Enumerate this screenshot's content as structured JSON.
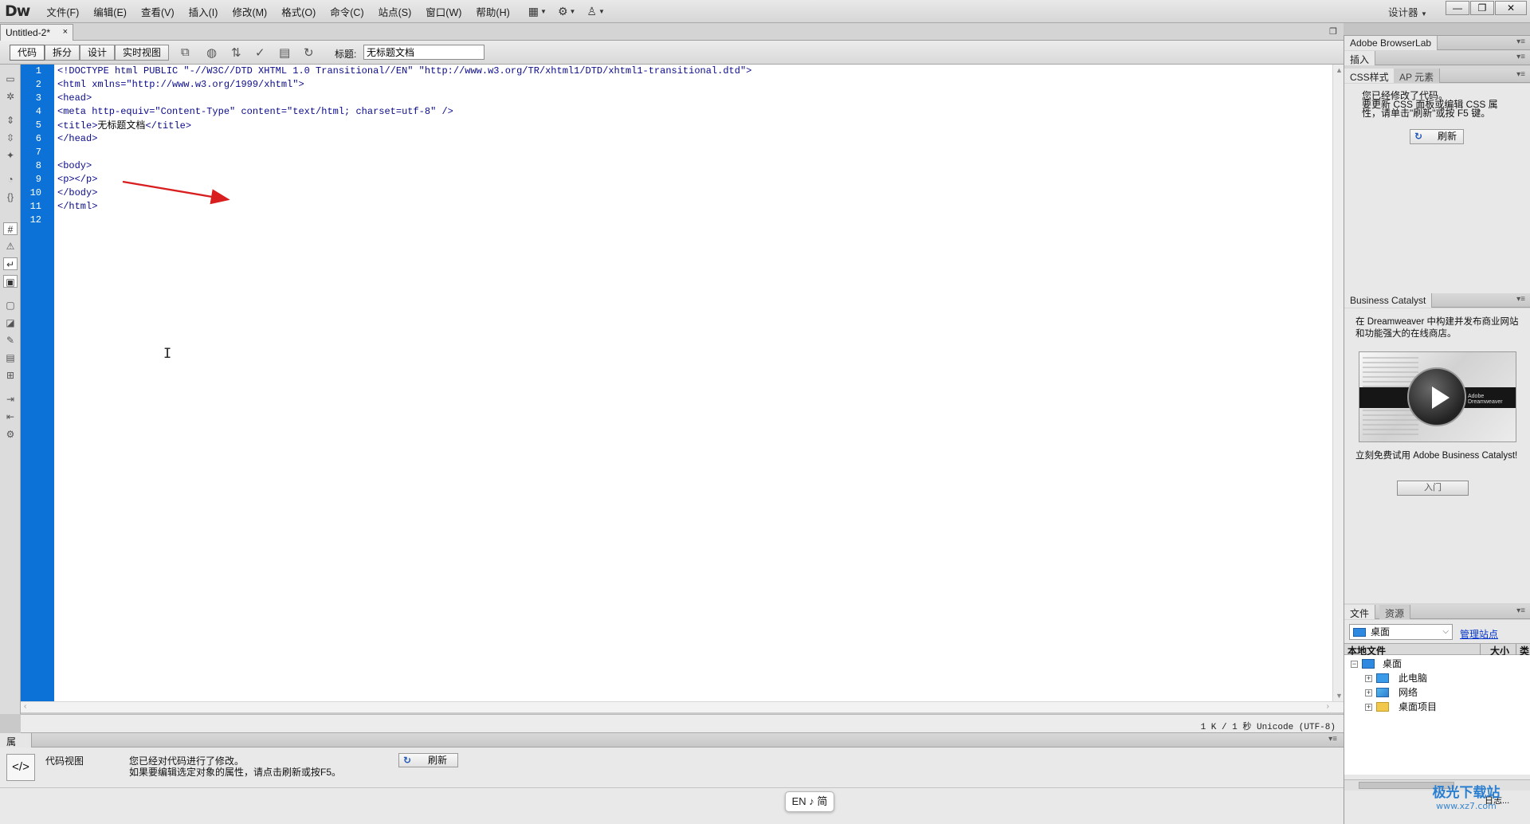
{
  "app": {
    "logo": "Dw",
    "menus": [
      "文件(F)",
      "编辑(E)",
      "查看(V)",
      "插入(I)",
      "修改(M)",
      "格式(O)",
      "命令(C)",
      "站点(S)",
      "窗口(W)",
      "帮助(H)"
    ],
    "workspace": "设计器",
    "window_buttons": {
      "minimize": "—",
      "restore": "❐",
      "close": "✕"
    }
  },
  "document": {
    "tab_label": "Untitled-2*",
    "tab_close": "×",
    "view_buttons": [
      "代码",
      "拆分",
      "设计",
      "实时视图"
    ],
    "title_label": "标题:",
    "title_value": "无标题文档"
  },
  "code": {
    "lines": [
      "<!DOCTYPE html PUBLIC \"-//W3C//DTD XHTML 1.0 Transitional//EN\" \"http://www.w3.org/TR/xhtml1/DTD/xhtml1-transitional.dtd\">",
      "<html xmlns=\"http://www.w3.org/1999/xhtml\">",
      "<head>",
      "<meta http-equiv=\"Content-Type\" content=\"text/html; charset=utf-8\" />",
      "<title>",
      "</head>",
      "",
      "<body>",
      "<p></p>",
      "</body>",
      "</html>",
      ""
    ],
    "title_text": "无标题文档",
    "title_close": "</title>",
    "line_numbers": [
      "1",
      "2",
      "3",
      "4",
      "5",
      "6",
      "7",
      "8",
      "9",
      "10",
      "11",
      "12"
    ]
  },
  "status": {
    "text": "1 K / 1 秒 Unicode (UTF-8)"
  },
  "properties": {
    "tab": "属性",
    "view_label": "代码视图",
    "message_line1": "您已经对代码进行了修改。",
    "message_line2": "如果要编辑选定对象的属性，请点击刷新或按F5。",
    "refresh_label": "刷新"
  },
  "ime": {
    "text": "EN ♪ 简"
  },
  "panels": {
    "browserlab": {
      "tab": "Adobe BrowserLab"
    },
    "insert": {
      "tab": "插入"
    },
    "css": {
      "tabs": [
        "CSS样式",
        "AP 元素"
      ],
      "message_lines": [
        "您已经修改了代码。",
        "要更新 CSS 面板或编辑 CSS 属",
        "性，请单击\"刷新\"或按 F5 键。"
      ],
      "refresh_label": "刷新"
    },
    "business_catalyst": {
      "tab": "Business Catalyst",
      "desc": "在 Dreamweaver 中构建并发布商业网站和功能强大的在线商店。",
      "trial": "立刻免费试用 Adobe Business Catalyst!",
      "start_label": "入门",
      "video_caption": "Adobe Dreamweaver"
    },
    "files": {
      "tabs": [
        "文件",
        "资源"
      ],
      "site": "桌面",
      "manage_sites": "管理站点",
      "columns": [
        "本地文件",
        "大小",
        "类型"
      ],
      "tree": [
        {
          "label": "桌面",
          "toggle": "−",
          "level": 0,
          "icon": "desktop"
        },
        {
          "label": "此电脑",
          "toggle": "+",
          "level": 1,
          "icon": "computer"
        },
        {
          "label": "网络",
          "toggle": "+",
          "level": 1,
          "icon": "network"
        },
        {
          "label": "桌面项目",
          "toggle": "+",
          "level": 1,
          "icon": "folder"
        }
      ],
      "log_label": "日志..."
    }
  },
  "watermark": {
    "main": "极光下载站",
    "sub": "www.xz7.com"
  }
}
